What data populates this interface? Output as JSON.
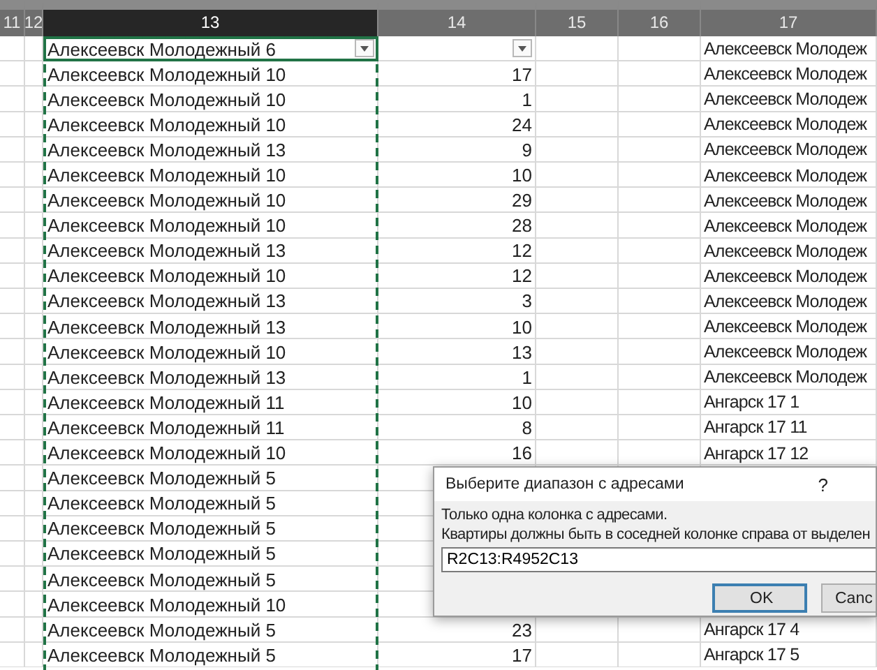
{
  "columns": [
    {
      "label": "11",
      "selected": false
    },
    {
      "label": "12",
      "selected": false
    },
    {
      "label": "13",
      "selected": true
    },
    {
      "label": "14",
      "selected": false
    },
    {
      "label": "15",
      "selected": false
    },
    {
      "label": "16",
      "selected": false
    },
    {
      "label": "17",
      "selected": false
    }
  ],
  "rows": [
    {
      "filter": true,
      "column_13": "Алексеевск Молодежный 6",
      "column_17": "Алексеевск Молодеж"
    },
    {
      "filter": false,
      "column_13": "Алексеевск Молодежный 10",
      "column_14": "17",
      "column_17": "Алексеевск Молодеж"
    },
    {
      "filter": false,
      "column_13": "Алексеевск Молодежный 10",
      "column_14": "1",
      "column_17": "Алексеевск Молодеж"
    },
    {
      "filter": false,
      "column_13": "Алексеевск Молодежный 10",
      "column_14": "24",
      "column_17": "Алексеевск Молодеж"
    },
    {
      "filter": false,
      "column_13": "Алексеевск Молодежный 13",
      "column_14": "9",
      "column_17": "Алексеевск Молодеж"
    },
    {
      "filter": false,
      "column_13": "Алексеевск Молодежный 10",
      "column_14": "10",
      "column_17": "Алексеевск Молодеж"
    },
    {
      "filter": false,
      "column_13": "Алексеевск Молодежный 10",
      "column_14": "29",
      "column_17": "Алексеевск Молодеж"
    },
    {
      "filter": false,
      "column_13": "Алексеевск Молодежный 10",
      "column_14": "28",
      "column_17": "Алексеевск Молодеж"
    },
    {
      "filter": false,
      "column_13": "Алексеевск Молодежный 13",
      "column_14": "12",
      "column_17": "Алексеевск Молодеж"
    },
    {
      "filter": false,
      "column_13": "Алексеевск Молодежный 10",
      "column_14": "12",
      "column_17": "Алексеевск Молодеж"
    },
    {
      "filter": false,
      "column_13": "Алексеевск Молодежный 13",
      "column_14": "3",
      "column_17": "Алексеевск Молодеж"
    },
    {
      "filter": false,
      "column_13": "Алексеевск Молодежный 13",
      "column_14": "10",
      "column_17": "Алексеевск Молодеж"
    },
    {
      "filter": false,
      "column_13": "Алексеевск Молодежный 10",
      "column_14": "13",
      "column_17": "Алексеевск Молодеж"
    },
    {
      "filter": false,
      "column_13": "Алексеевск Молодежный 13",
      "column_14": "1",
      "column_17": "Алексеевск Молодеж"
    },
    {
      "filter": false,
      "column_13": "Алексеевск Молодежный 11",
      "column_14": "10",
      "column_17": "Ангарск 17 1"
    },
    {
      "filter": false,
      "column_13": "Алексеевск Молодежный 11",
      "column_14": "8",
      "column_17": "Ангарск 17 11"
    },
    {
      "filter": false,
      "column_13": "Алексеевск Молодежный 10",
      "column_14": "16",
      "column_17": "Ангарск 17 12"
    },
    {
      "filter": false,
      "column_13": "Алексеевск Молодежный 5"
    },
    {
      "filter": false,
      "column_13": "Алексеевск Молодежный 5"
    },
    {
      "filter": false,
      "column_13": "Алексеевск Молодежный 5"
    },
    {
      "filter": false,
      "column_13": "Алексеевск Молодежный 5"
    },
    {
      "filter": false,
      "column_13": "Алексеевск Молодежный 5"
    },
    {
      "filter": false,
      "column_13": "Алексеевск Молодежный 10"
    },
    {
      "filter": false,
      "column_13": "Алексеевск Молодежный 5",
      "column_14": "23",
      "column_17": "Ангарск 17 4"
    },
    {
      "filter": false,
      "column_13": "Алексеевск Молодежный 5",
      "column_14": "17",
      "column_17": "Ангарск 17 5"
    }
  ],
  "dialog": {
    "title": "Выберите диапазон с адресами",
    "help": "?",
    "lines": [
      "Только одна колонка с адресами.",
      "Квартиры должны быть в соседней колонке справа от выделен"
    ],
    "input_value": "R2C13:R4952C13",
    "buttons": [
      {
        "label": "OK",
        "focused": true
      },
      {
        "label": "Canc",
        "focused": false
      }
    ]
  }
}
